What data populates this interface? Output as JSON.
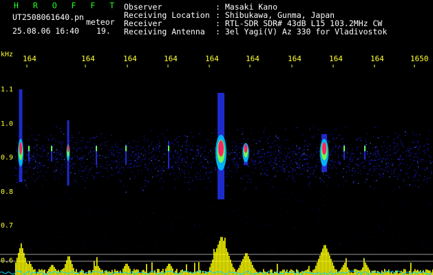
{
  "header": {
    "app_name": "H R O F F T",
    "filename": "UT2508061640.pn",
    "tag": "meteor",
    "datetime": "25.08.06 16:40",
    "count": "19.",
    "fields": [
      {
        "label": "Observer",
        "value": ": Masaki Kano"
      },
      {
        "label": "Receiving Location",
        "value": ": Shibukawa, Gunma, Japan"
      },
      {
        "label": "Receiver",
        "value": ": RTL-SDR SDR# 43dB L15 103.2MHz CW"
      },
      {
        "label": "Receiving Antenna",
        "value": ": 3el Yagi(V) Az 330 for Vladivostok"
      }
    ]
  },
  "spectrogram": {
    "frequency_unit": "kHz",
    "y_ticks": [
      "1.1",
      "1.0",
      "0.9",
      "0.8",
      "0.7",
      "0.6"
    ],
    "time_ticks": [
      "164",
      "164",
      "164",
      "164",
      "164",
      "164",
      "164",
      "164",
      "164",
      "1650"
    ],
    "colors": {
      "background": "#000000",
      "noise": "#1010a0",
      "echo_core": "#ff2266",
      "histogram": "#ffff00",
      "noise_floor": "#00d8ff",
      "axis_labels": "#ffff33"
    }
  }
}
